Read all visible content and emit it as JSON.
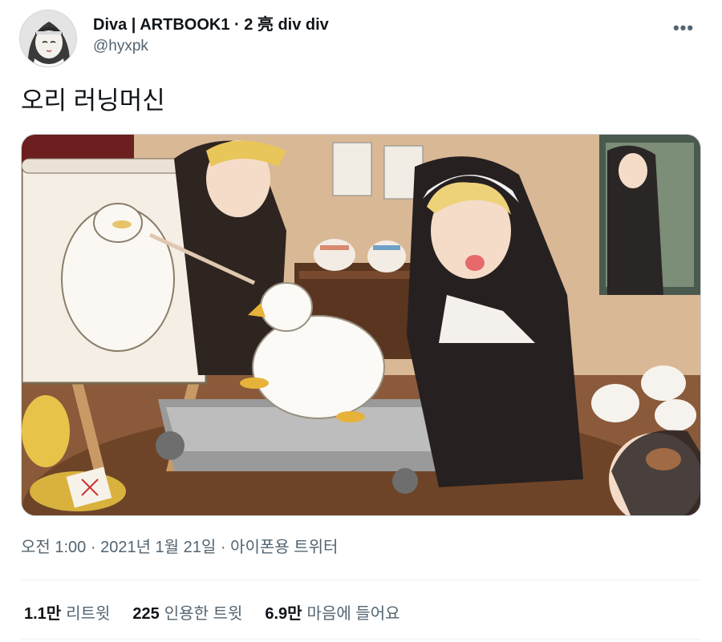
{
  "author": {
    "display_name": "Diva | ARTBOOK1 · 2 亮 div div",
    "handle": "@hyxpk",
    "avatar_icon": "user-avatar-illustration"
  },
  "more_icon": "more-horizontal-icon",
  "more_label": "•••",
  "tweet": {
    "text": "오리 러닝머신"
  },
  "media": {
    "icon": "illustration-image"
  },
  "meta": {
    "time": "오전 1:00",
    "sep1": " · ",
    "date": "2021년 1월 21일",
    "sep2": " · ",
    "source": "아이폰용 트위터"
  },
  "stats": [
    {
      "value": "1.1만",
      "label": "리트윗"
    },
    {
      "value": "225",
      "label": "인용한 트윗"
    },
    {
      "value": "6.9만",
      "label": "마음에 들어요"
    }
  ],
  "colors": {
    "primary_text": "#0f1419",
    "secondary_text": "#536471",
    "border": "#cfd9de",
    "divider": "#eff3f4"
  }
}
